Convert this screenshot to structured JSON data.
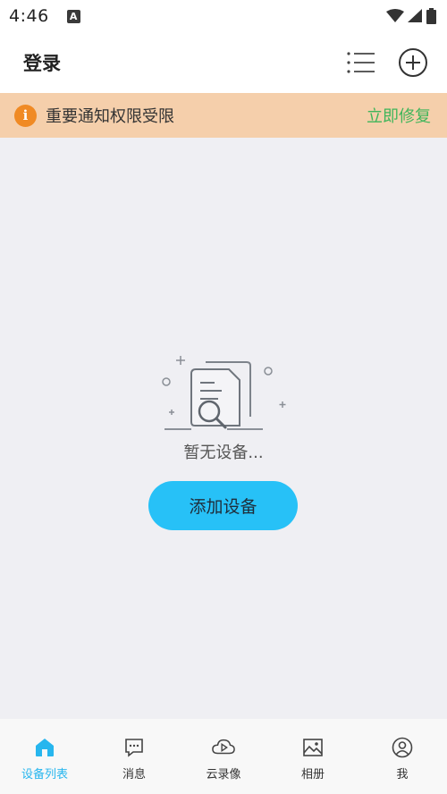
{
  "status_bar": {
    "time": "4:46",
    "notification_icon": "a-letter-icon",
    "icons": [
      "wifi-icon",
      "signal-icon",
      "battery-icon"
    ]
  },
  "header": {
    "title": "登录",
    "actions": [
      "list-icon",
      "add-circle-icon"
    ]
  },
  "notice": {
    "icon": "info-icon",
    "icon_glyph": "i",
    "text": "重要通知权限受限",
    "action_label": "立即修复",
    "background": "#f5cfab",
    "action_color": "#3fb55a"
  },
  "empty_state": {
    "illustration": "no-document-search-icon",
    "message": "暂无设备...",
    "button_label": "添加设备",
    "button_color": "#27c1f7"
  },
  "tabbar": {
    "active_color": "#27b6ee",
    "tabs": [
      {
        "label": "设备列表",
        "icon": "home-icon",
        "active": true
      },
      {
        "label": "消息",
        "icon": "message-icon",
        "active": false
      },
      {
        "label": "云录像",
        "icon": "cloud-video-icon",
        "active": false
      },
      {
        "label": "相册",
        "icon": "album-icon",
        "active": false
      },
      {
        "label": "我",
        "icon": "user-icon",
        "active": false
      }
    ]
  }
}
